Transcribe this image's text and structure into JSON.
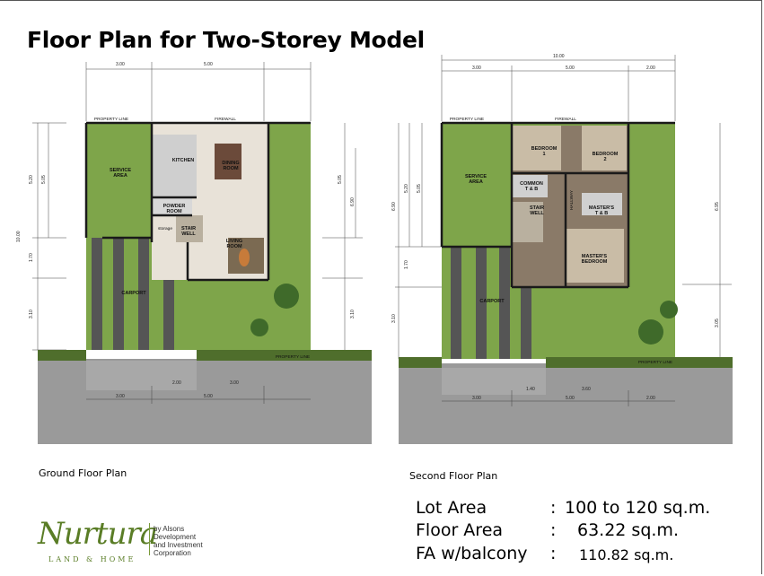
{
  "title": "Floor Plan for Two-Storey Model",
  "ground": {
    "caption": "Ground Floor Plan",
    "dims_top": [
      "3.00",
      "5.00"
    ],
    "dims_bottom": [
      "3.00",
      "5.00",
      "2.00",
      "3.00"
    ],
    "dims_left": [
      "5.20",
      "5.05",
      "10.00",
      "1.70",
      "3.10"
    ],
    "dims_right": [
      "5.05",
      "6.90",
      "3.10"
    ],
    "property_line": "PROPERTY LINE",
    "firewall": "FIREWALL",
    "rooms": {
      "service_area": "SERVICE\nAREA",
      "kitchen": "KITCHEN",
      "dining": "DINING\nROOM",
      "powder": "POWDER\nROOM",
      "stair": "STAIR\nWELL",
      "storage": "storage",
      "living": "LIVING\nROOM",
      "carport": "CARPORT"
    }
  },
  "second": {
    "caption": "Second Floor Plan",
    "dims_top": [
      "10.00",
      "3.00",
      "5.00",
      "2.00"
    ],
    "dims_bottom": [
      "1.40",
      "3.60",
      "3.00",
      "5.00",
      "2.00"
    ],
    "dims_left": [
      "6.90",
      "5.20",
      "5.05",
      "1.70",
      "3.10"
    ],
    "dims_right": [
      "6.95",
      "3.05"
    ],
    "property_line": "PROPERTY LINE",
    "firewall": "FIREWALL",
    "rooms": {
      "bedroom1": "BEDROOM\n1",
      "bedroom2": "BEDROOM\n2",
      "service_area": "SERVICE\nAREA",
      "common_tb": "COMMON\nT & B",
      "hallway": "HALLWAY",
      "masters_tb": "MASTER'S\nT & B",
      "stair": "STAIR\nWELL",
      "masters_bedroom": "MASTER'S\nBEDROOM",
      "carport": "CARPORT"
    }
  },
  "specs": [
    {
      "label": "Lot Area",
      "colon": ":",
      "value": "100 to 120 sq.m."
    },
    {
      "label": "Floor Area",
      "colon": ":",
      "value": "63.22  sq.m."
    },
    {
      "label": "FA w/balcony",
      "colon": ":",
      "value": "110.82 sq.m."
    }
  ],
  "logo": {
    "brand": "Nurtura",
    "sub": "LAND & HOME",
    "corp_line1": "by Alsons",
    "corp_line2": "Development",
    "corp_line3": "and Investment",
    "corp_line4": "Corporation"
  },
  "colors": {
    "grass": "#7ea54a",
    "pavement": "#9a9a9a",
    "floor": "#e8e2d8",
    "wall": "#1a1a1a",
    "brand": "#5a7d26"
  }
}
